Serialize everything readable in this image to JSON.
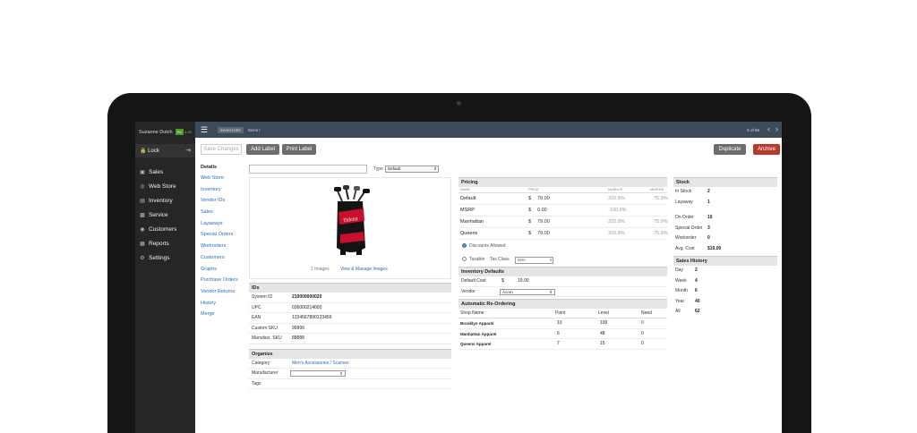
{
  "sidebar": {
    "user_name": "Suzanne Dutch",
    "register_badge": "R1",
    "time": "3:45",
    "lock_label": "Lock",
    "items": [
      {
        "label": "Sales",
        "icon": "cart-icon"
      },
      {
        "label": "Web Store",
        "icon": "globe-icon"
      },
      {
        "label": "Inventory",
        "icon": "box-icon"
      },
      {
        "label": "Service",
        "icon": "truck-icon"
      },
      {
        "label": "Customers",
        "icon": "person-icon"
      },
      {
        "label": "Reports",
        "icon": "chart-icon"
      },
      {
        "label": "Settings",
        "icon": "gear-icon"
      }
    ]
  },
  "topbar": {
    "section": "INVENTORY",
    "crumb": "Items /",
    "pager": "5 of 66"
  },
  "toolbar": {
    "save": "Save Changes",
    "add_label": "Add Label",
    "print_label": "Print Label",
    "duplicate": "Duplicate",
    "archive": "Archive"
  },
  "subnav": {
    "header": "Details",
    "links": [
      "Web Store",
      "Inventory",
      "Vendor IDs",
      "Sales",
      "Layaways",
      "Special Orders",
      "Workorders",
      "Customers",
      "Graphs",
      "Purchase Orders",
      "Vendor Returns",
      "History",
      "Merge"
    ]
  },
  "details": {
    "type_label": "Type",
    "type_value": "Default",
    "image_count": "1 Images",
    "image_manage": "View & Manage Images",
    "brand_text": "Titleist"
  },
  "ids": {
    "title": "IDs",
    "rows": [
      {
        "k": "System ID",
        "v": "210000000020"
      },
      {
        "k": "UPC",
        "v": "036000214000"
      },
      {
        "k": "EAN",
        "v": "1234567890123456"
      },
      {
        "k": "Custom SKU",
        "v": "99999"
      },
      {
        "k": "Manufact. SKU",
        "v": "88888"
      }
    ]
  },
  "organize": {
    "title": "Organize",
    "category_label": "Category",
    "category_value": "Men's Accessories / Scarves",
    "manufacturer_label": "Manufacturer",
    "tags_label": "Tags"
  },
  "pricing": {
    "title": "Pricing",
    "headers": {
      "name": "NAME",
      "price": "PRICE",
      "markup": "MARKUP",
      "margin": "MARGIN"
    },
    "rows": [
      {
        "name": "Default",
        "cur": "$",
        "price": "79.00",
        "markup": "315.8%",
        "margin": "75.9%"
      },
      {
        "name": "MSRP",
        "cur": "$",
        "price": "0.00",
        "markup": "-100.0%",
        "margin": ""
      },
      {
        "name": "Manhattan",
        "cur": "$",
        "price": "79.00",
        "markup": "315.8%",
        "margin": "75.9%"
      },
      {
        "name": "Queens",
        "cur": "$",
        "price": "79.00",
        "markup": "315.8%",
        "margin": "75.9%"
      }
    ],
    "discounts_label": "Discounts Allowed",
    "taxable_label": "Taxable",
    "tax_class_label": "Tax Class",
    "tax_class_value": "Item"
  },
  "inventory_defaults": {
    "title": "Inventory Defaults",
    "default_cost_label": "Default Cost",
    "default_cost_cur": "$",
    "default_cost_value": "19.00",
    "vendor_label": "Vendor",
    "vendor_value": "Acorn"
  },
  "reordering": {
    "title": "Automatic Re-Ordering",
    "headers": [
      "Shop Name",
      "Point",
      "Level",
      "Need"
    ],
    "rows": [
      {
        "shop": "Brooklyn Apparel",
        "point": "10",
        "level": "100",
        "need": "0"
      },
      {
        "shop": "Manhattan Apparel",
        "point": "6",
        "level": "48",
        "need": "0"
      },
      {
        "shop": "Queens Apparel",
        "point": "7",
        "level": "15",
        "need": "0"
      }
    ]
  },
  "stock": {
    "title": "Stock",
    "rows": [
      {
        "k": "In Stock",
        "v": "2"
      },
      {
        "k": "Layaway",
        "v": "1"
      }
    ],
    "rows2": [
      {
        "k": "On Order",
        "v": "16"
      },
      {
        "k": "Special Order",
        "v": "3"
      },
      {
        "k": "Workorder",
        "v": "0"
      }
    ],
    "avg_cost_label": "Avg. Cost",
    "avg_cost_value": "$19.00"
  },
  "sales_history": {
    "title": "Sales History",
    "rows": [
      {
        "k": "Day",
        "v": "2"
      },
      {
        "k": "Week",
        "v": "4"
      },
      {
        "k": "Month",
        "v": "6"
      },
      {
        "k": "Year",
        "v": "40"
      },
      {
        "k": "All",
        "v": "62"
      }
    ]
  },
  "colors": {
    "accent_red": "#b73a2e",
    "topbar": "#3d4a57",
    "sidebar": "#262626",
    "link": "#2a6fb5"
  }
}
